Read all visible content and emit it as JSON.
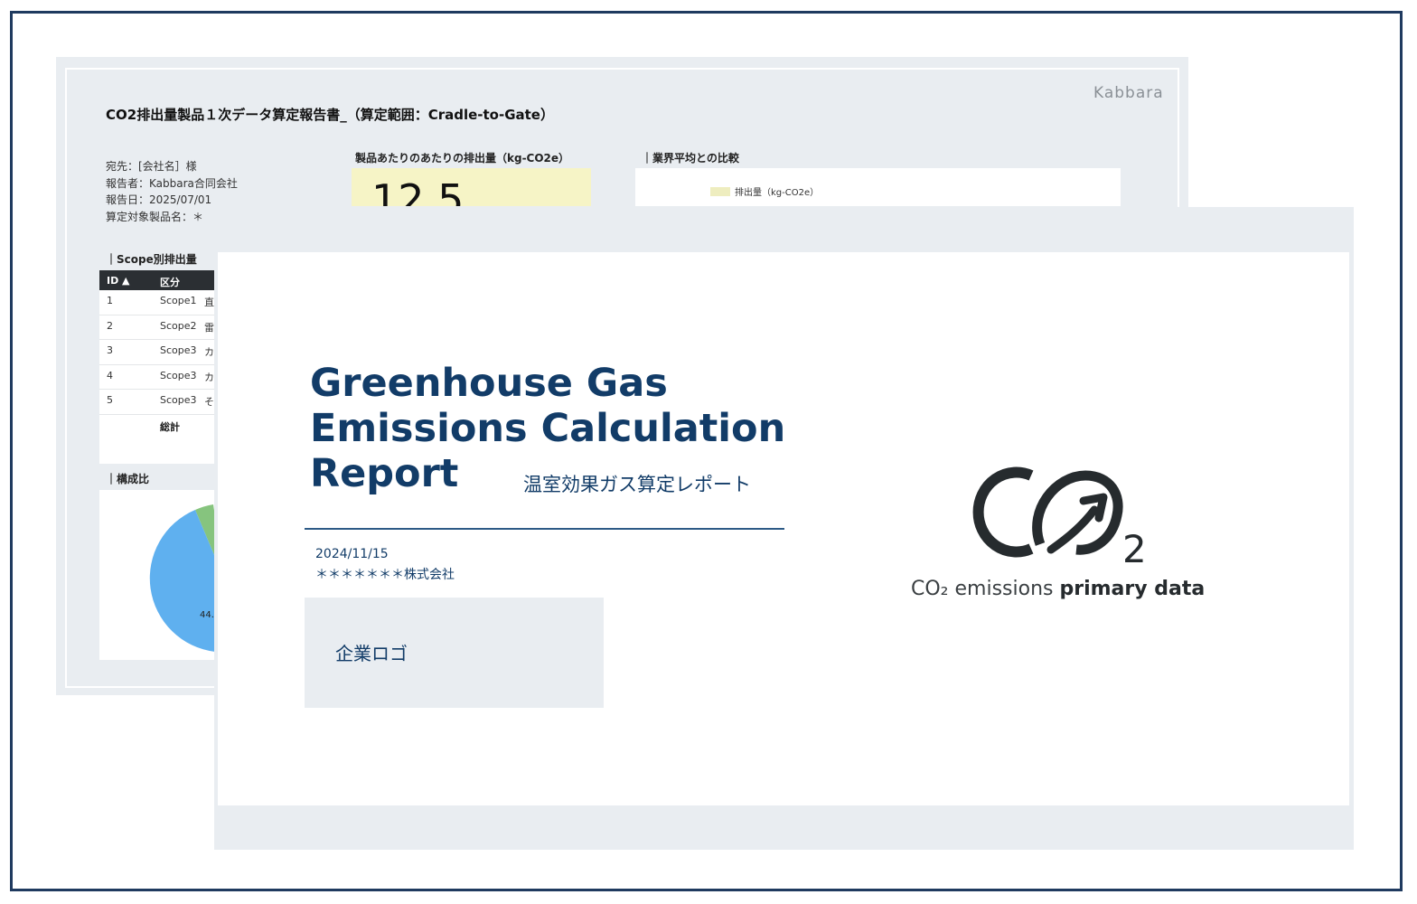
{
  "back_report": {
    "brand": "Kabbara",
    "title": "CO2排出量製品１次データ算定報告書_（算定範囲：Cradle-to-Gate）",
    "meta": {
      "recipient": "宛先：[会社名］様",
      "reporter": "報告者：Kabbara合同会社",
      "report_date": "報告日：2025/07/01",
      "product": "算定対象製品名：＊"
    },
    "kpi_label": "製品あたりのあたりの排出量（kg-CO2e）",
    "kpi_value": "12.5",
    "comparison_label": "｜業界平均との比較",
    "comparison_legend": "排出量（kg-CO2e）",
    "scope_label": "｜Scope別排出量",
    "table": {
      "headers": [
        "ID ▲",
        "区分"
      ],
      "rows": [
        {
          "id": "1",
          "scope": "Scope1",
          "cat": "直"
        },
        {
          "id": "2",
          "scope": "Scope2",
          "cat": "雷"
        },
        {
          "id": "3",
          "scope": "Scope3",
          "cat": "カ"
        },
        {
          "id": "4",
          "scope": "Scope3",
          "cat": "カ"
        },
        {
          "id": "5",
          "scope": "Scope3",
          "cat": "そ"
        }
      ],
      "total_label": "総計"
    },
    "composition_label": "｜構成比",
    "pie_label": "44."
  },
  "cover": {
    "title_lines": [
      "Greenhouse Gas",
      "Emissions Calculation",
      "Report"
    ],
    "title_jp": "温室効果ガス算定レポート",
    "date": "2024/11/15",
    "company": "＊＊＊＊＊＊＊株式会社",
    "logo_placeholder": "企業ロゴ",
    "co2_logo_subscript": "2",
    "tagline_prefix": "CO₂ emissions ",
    "tagline_bold": "primary data",
    "colors": {
      "navy": "#123c68",
      "logo_dark": "#262b2e",
      "sheet_gray": "#e9edf1"
    }
  }
}
